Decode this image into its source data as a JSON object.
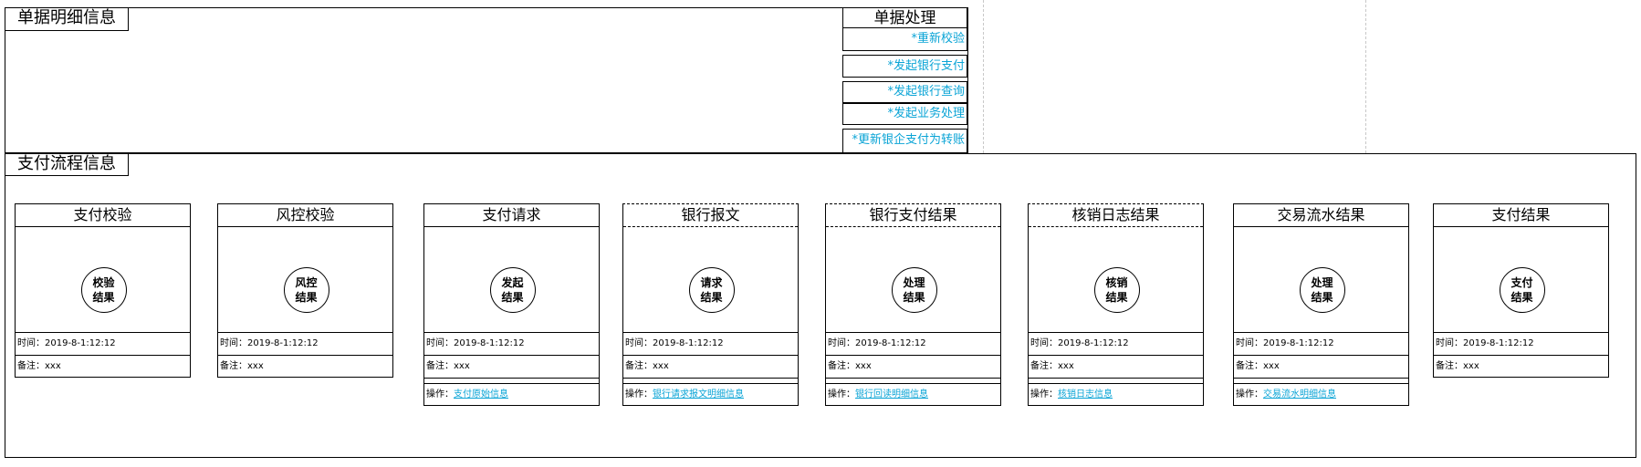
{
  "detail": {
    "tab_label": "单据明细信息"
  },
  "processing": {
    "title": "单据处理",
    "actions": [
      "*重新校验",
      "*发起银行支付",
      "*发起银行查询",
      "*发起业务处理",
      "*更新银企支付为转账"
    ]
  },
  "flow": {
    "tab_label": "支付流程信息",
    "time_label": "时间：",
    "note_label": "备注：",
    "op_label": "操作：",
    "steps": [
      {
        "title": "支付校验",
        "circle_top": "校验",
        "circle_bottom": "结果",
        "time": "2019-8-1:12:12",
        "note": "xxx",
        "op": ""
      },
      {
        "title": "风控校验",
        "circle_top": "风控",
        "circle_bottom": "结果",
        "time": "2019-8-1:12:12",
        "note": "xxx",
        "op": ""
      },
      {
        "title": "支付请求",
        "circle_top": "发起",
        "circle_bottom": "结果",
        "time": "2019-8-1:12:12",
        "note": "xxx",
        "op": "支付原始信息"
      },
      {
        "title": "银行报文",
        "circle_top": "请求",
        "circle_bottom": "结果",
        "time": "2019-8-1:12:12",
        "note": "xxx",
        "op": "银行请求报文明细信息"
      },
      {
        "title": "银行支付结果",
        "circle_top": "处理",
        "circle_bottom": "结果",
        "time": "2019-8-1:12:12",
        "note": "xxx",
        "op": "银行回读明细信息"
      },
      {
        "title": "核销日志结果",
        "circle_top": "核销",
        "circle_bottom": "结果",
        "time": "2019-8-1:12:12",
        "note": "xxx",
        "op": "核销日志信息"
      },
      {
        "title": "交易流水结果",
        "circle_top": "处理",
        "circle_bottom": "结果",
        "time": "2019-8-1:12:12",
        "note": "xxx",
        "op": "交易流水明细信息"
      },
      {
        "title": "支付结果",
        "circle_top": "支付",
        "circle_bottom": "结果",
        "time": "2019-8-1:12:12",
        "note": "xxx",
        "op": ""
      }
    ]
  }
}
